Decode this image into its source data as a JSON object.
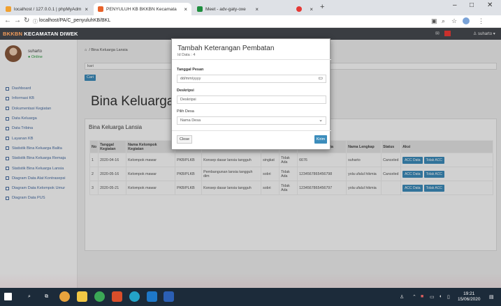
{
  "browser": {
    "tabs": [
      {
        "label": "localhost / 127.0.0.1 | phpMyAdm"
      },
      {
        "label": "PENYULUH KB BKKBN Kecamata"
      },
      {
        "label": "Meet - adv-gaty-oxe"
      },
      {
        "label": ""
      }
    ],
    "url": "localhost/PA/C_penyuluhKB/BKL"
  },
  "app": {
    "brand_prefix": "BKKBN",
    "brand_rest": " KECAMATAN DIWEK",
    "user_top": "suharto"
  },
  "sidebar": {
    "user_name": "suharto",
    "status": "Online",
    "items": [
      {
        "label": "Dashboard"
      },
      {
        "label": "Informasi KB"
      },
      {
        "label": "Dokumentasi Kegiatan"
      },
      {
        "label": "Data Keluarga"
      },
      {
        "label": "Data Tribina"
      },
      {
        "label": "Layanan KB"
      },
      {
        "label": "Statistik Bina Keluarga Balita"
      },
      {
        "label": "Statistik Bina Keluarga Remaja"
      },
      {
        "label": "Statistik Bina Keluarga Lansia"
      },
      {
        "label": "Diagram Data Alat Kontrasepsi"
      },
      {
        "label": "Diagram Data Kelompok Umur"
      },
      {
        "label": "Diagram Data PUS"
      }
    ]
  },
  "main": {
    "breadcrumb": "Bina Keluarga Lansia",
    "search_value": "kari",
    "search_button": "Cari",
    "title": "Bina Keluarga La",
    "panel_title": "Bina Keluarga Lansia",
    "table": {
      "headers": [
        "No",
        "Tanggal Kegiatan",
        "Nama Kelompok Kegiatan",
        "",
        "",
        "",
        "",
        "Keluarga Indonesia",
        "Nama Lengkap",
        "Status",
        "Aksi"
      ],
      "rows": [
        {
          "no": "1",
          "tanggal": "2020-04-16",
          "kelompok": "Kelompok mawar",
          "c4": "PKB/PLKB",
          "materi": "Konsep dasar lansia tangguh",
          "nama": "singkat",
          "tidak": "Tidak Ada",
          "nik": "6676",
          "lengkap": "suharto",
          "status": "Canceled",
          "acc": "ACC Data",
          "tolak": "Tolak ACC"
        },
        {
          "no": "2",
          "tanggal": "2020-05-16",
          "kelompok": "Kelompok mawar",
          "c4": "PKB/PLKB",
          "materi": "Pembangunan lansia tangguh dim",
          "nama": "sobri",
          "tidak": "Tidak Ada",
          "nik": "1234567865456798",
          "lengkap": "yola ufalul hikmia",
          "status": "Canceled",
          "acc": "ACC Data",
          "tolak": "Tolak ACC"
        },
        {
          "no": "3",
          "tanggal": "2020-05-21",
          "kelompok": "Kelompok mawar",
          "c4": "PKB/PLKB",
          "materi": "Konsep dasar lansia tangguh",
          "nama": "sobri",
          "tidak": "Tidak Ada",
          "nik": "1234567865456797",
          "lengkap": "yola ufalul hikmia",
          "status": "",
          "acc": "ACC Data",
          "tolak": "Tolak ACC"
        }
      ]
    }
  },
  "modal": {
    "title": "Tambah Keterangan Pembatan",
    "subtitle": "Id Data : 4",
    "date_label": "Tanggal Pesan",
    "date_placeholder": "dd/mm/yyyy",
    "desc_label": "Deskripsi",
    "desc_placeholder": "Deskripsi",
    "desa_label": "Pilih Desa",
    "desa_value": "Nama Desa",
    "close_label": "Close",
    "save_label": "Kirim"
  },
  "taskbar": {
    "time": "19:21",
    "date": "15/06/2020"
  },
  "colors": {
    "accent": "#3c8dbc",
    "topbar": "#3a3d42",
    "brand_orange": "#f39c5a"
  }
}
